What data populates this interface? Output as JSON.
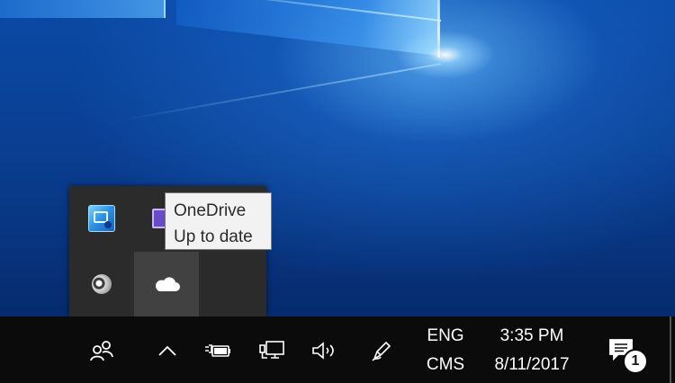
{
  "tooltip": {
    "title": "OneDrive",
    "status": "Up to date"
  },
  "tray_overflow": {
    "icons": [
      "intel-graphics-icon",
      "monitor-icon",
      "speaker-icon",
      "onedrive-cloud-icon"
    ]
  },
  "taskbar": {
    "icons": {
      "people": "people-icon",
      "show_hidden": "chevron-up-icon",
      "power": "battery-charging-icon",
      "network": "network-icon",
      "volume": "volume-icon",
      "pen": "pen-workspace-icon",
      "action_center": "notification-icon"
    },
    "language": {
      "primary": "ENG",
      "secondary": "CMS"
    },
    "clock": {
      "time": "3:35 PM",
      "date": "8/11/2017"
    },
    "notification_count": "1"
  },
  "colors": {
    "taskbar": "#0b0b0b",
    "tray": "#2b2b2b",
    "tray_hover": "#414141",
    "tooltip_bg": "#f2f2f2",
    "desktop_blue": "#0a4aa6"
  }
}
